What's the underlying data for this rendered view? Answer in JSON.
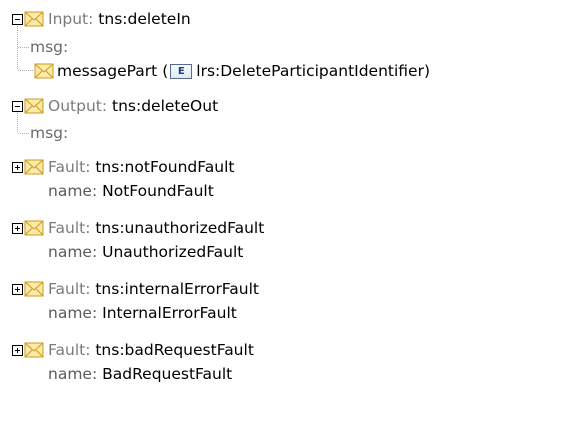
{
  "input": {
    "label": "Input:",
    "value": "tns:deleteIn",
    "msg_label": "msg:",
    "part": {
      "name": "messagePart",
      "open": "(",
      "badge": "E",
      "type": "lrs:DeleteParticipantIdentifier",
      "close": ")"
    }
  },
  "output": {
    "label": "Output:",
    "value": "tns:deleteOut",
    "msg_label": "msg:"
  },
  "faults": [
    {
      "label": "Fault:",
      "value": "tns:notFoundFault",
      "name_label": "name:",
      "name_value": "NotFoundFault"
    },
    {
      "label": "Fault:",
      "value": "tns:unauthorizedFault",
      "name_label": "name:",
      "name_value": "UnauthorizedFault"
    },
    {
      "label": "Fault:",
      "value": "tns:internalErrorFault",
      "name_label": "name:",
      "name_value": "InternalErrorFault"
    },
    {
      "label": "Fault:",
      "value": "tns:badRequestFault",
      "name_label": "name:",
      "name_value": "BadRequestFault"
    }
  ],
  "colors": {
    "envelope_fill": "#fde9a8",
    "envelope_stroke": "#c89b1c",
    "label_gray": "#7b7b7b",
    "tree_line": "#b0b0b0",
    "badge_text": "#1b3f7a"
  },
  "icons": {
    "expand": "plus-box-icon",
    "collapse": "minus-box-icon",
    "message": "envelope-icon",
    "element": "element-badge-icon"
  }
}
